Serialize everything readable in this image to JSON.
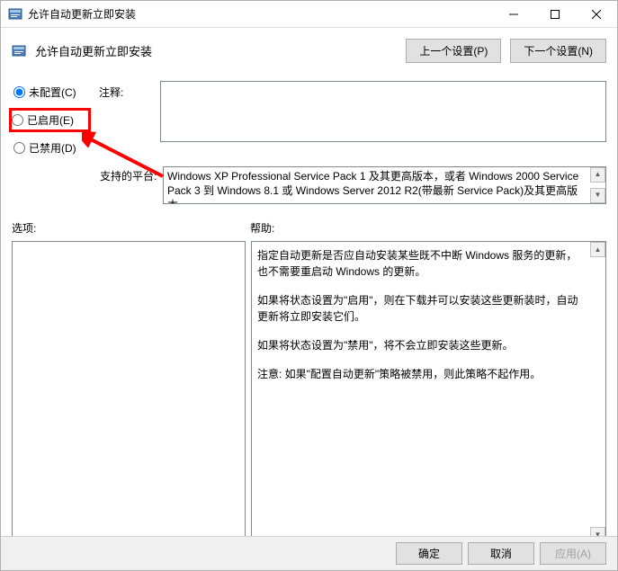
{
  "titlebar": {
    "title": "允许自动更新立即安装"
  },
  "header": {
    "title": "允许自动更新立即安装",
    "prev_button": "上一个设置(P)",
    "next_button": "下一个设置(N)"
  },
  "radios": {
    "not_configured": "未配置(C)",
    "enabled": "已启用(E)",
    "disabled": "已禁用(D)"
  },
  "comment": {
    "label": "注释:",
    "value": ""
  },
  "platform": {
    "label": "支持的平台:",
    "text": "Windows XP Professional Service Pack 1 及其更高版本，或者 Windows 2000 Service Pack 3 到 Windows 8.1 或 Windows Server 2012 R2(带最新 Service Pack)及其更高版本"
  },
  "labels": {
    "options": "选项:",
    "help": "帮助:"
  },
  "help": {
    "p1": "指定自动更新是否应自动安装某些既不中断 Windows 服务的更新，也不需要重启动 Windows 的更新。",
    "p2": "如果将状态设置为\"启用\"，则在下载并可以安装这些更新装时，自动更新将立即安装它们。",
    "p3": "如果将状态设置为\"禁用\"，将不会立即安装这些更新。",
    "p4": "注意: 如果\"配置自动更新\"策略被禁用，则此策略不起作用。"
  },
  "footer": {
    "ok": "确定",
    "cancel": "取消",
    "apply": "应用(A)"
  }
}
